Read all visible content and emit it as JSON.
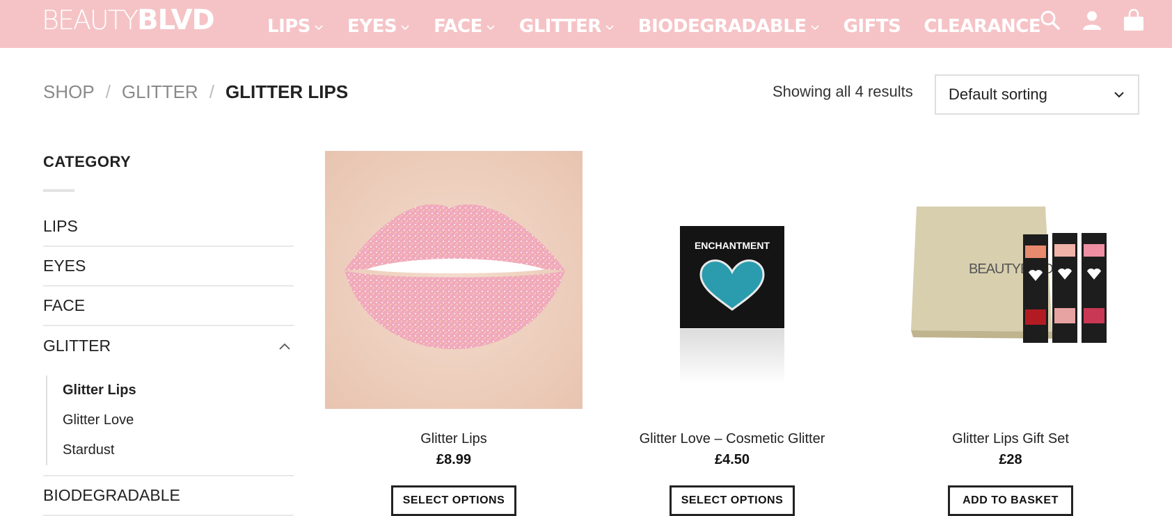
{
  "header": {
    "logo_thin": "BEAUTY",
    "logo_bold": "BLVD",
    "nav": [
      {
        "label": "LIPS",
        "dropdown": true
      },
      {
        "label": "EYES",
        "dropdown": true
      },
      {
        "label": "FACE",
        "dropdown": true
      },
      {
        "label": "GLITTER",
        "dropdown": true
      },
      {
        "label": "BIODEGRADABLE",
        "dropdown": true
      },
      {
        "label": "GIFTS",
        "dropdown": false
      },
      {
        "label": "CLEARANCE",
        "dropdown": false
      }
    ],
    "icons": [
      "search-icon",
      "account-icon",
      "basket-icon"
    ],
    "background_color": "#f5c3c6"
  },
  "breadcrumb": {
    "items": [
      "SHOP",
      "GLITTER"
    ],
    "separator": "/",
    "current": "GLITTER LIPS"
  },
  "results_text": "Showing all 4 results",
  "sort": {
    "selected": "Default sorting"
  },
  "sidebar": {
    "title": "CATEGORY",
    "categories": [
      {
        "label": "LIPS"
      },
      {
        "label": "EYES"
      },
      {
        "label": "FACE"
      },
      {
        "label": "GLITTER",
        "expanded": true,
        "subcategories": [
          {
            "label": "Glitter Lips",
            "active": true
          },
          {
            "label": "Glitter Love",
            "active": false
          },
          {
            "label": "Stardust",
            "active": false
          }
        ]
      },
      {
        "label": "BIODEGRADABLE"
      }
    ]
  },
  "products": [
    {
      "name": "Glitter Lips",
      "price": "£8.99",
      "button": "SELECT OPTIONS",
      "image": "glitter-lips-image"
    },
    {
      "name": "Glitter Love – Cosmetic Glitter",
      "price": "£4.50",
      "button": "SELECT OPTIONS",
      "image": "glitter-love-image",
      "image_text": "ENCHANTMENT"
    },
    {
      "name": "Glitter Lips Gift Set",
      "price": "£28",
      "button": "ADD TO BASKET",
      "image": "gift-set-image",
      "image_text": "BEAUTYBLVD"
    }
  ]
}
